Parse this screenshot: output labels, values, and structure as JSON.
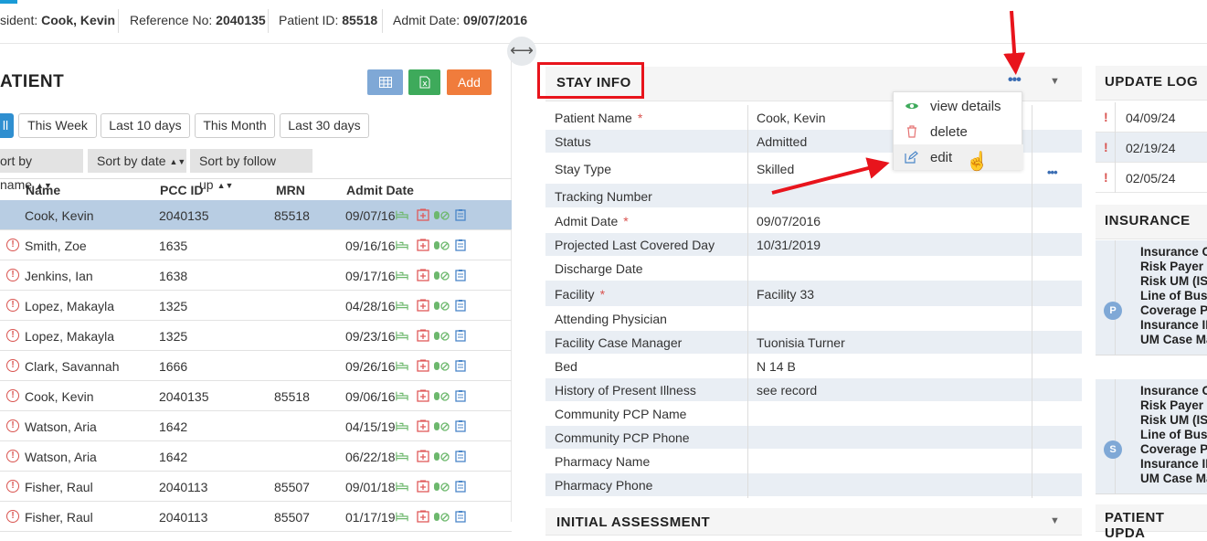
{
  "header": {
    "resident_label": "sident:",
    "resident_value": "Cook, Kevin",
    "reference_label": "Reference No:",
    "reference_value": "2040135",
    "patient_id_label": "Patient ID:",
    "patient_id_value": "85518",
    "admit_label": "Admit Date:",
    "admit_value": "09/07/2016"
  },
  "left": {
    "title": "ATIENT",
    "add_label": "Add",
    "tabs": [
      "ll",
      "This Week",
      "Last 10 days",
      "This Month",
      "Last 30 days"
    ],
    "sorts": [
      "ort by name",
      "Sort by date",
      "Sort by follow up"
    ],
    "columns": {
      "name": "Name",
      "pcc": "PCC ID",
      "mrn": "MRN",
      "admit": "Admit Date"
    },
    "rows": [
      {
        "name": "Cook, Kevin",
        "pcc": "2040135",
        "mrn": "85518",
        "date": "09/07/16"
      },
      {
        "name": "Smith, Zoe",
        "pcc": "1635",
        "mrn": "",
        "date": "09/16/16"
      },
      {
        "name": "Jenkins, Ian",
        "pcc": "1638",
        "mrn": "",
        "date": "09/17/16"
      },
      {
        "name": "Lopez, Makayla",
        "pcc": "1325",
        "mrn": "",
        "date": "04/28/16"
      },
      {
        "name": "Lopez, Makayla",
        "pcc": "1325",
        "mrn": "",
        "date": "09/23/16"
      },
      {
        "name": "Clark, Savannah",
        "pcc": "1666",
        "mrn": "",
        "date": "09/26/16"
      },
      {
        "name": "Cook, Kevin",
        "pcc": "2040135",
        "mrn": "85518",
        "date": "09/06/16"
      },
      {
        "name": "Watson, Aria",
        "pcc": "1642",
        "mrn": "",
        "date": "04/15/19"
      },
      {
        "name": "Watson, Aria",
        "pcc": "1642",
        "mrn": "",
        "date": "06/22/18"
      },
      {
        "name": "Fisher, Raul",
        "pcc": "2040113",
        "mrn": "85507",
        "date": "09/01/18"
      },
      {
        "name": "Fisher, Raul",
        "pcc": "2040113",
        "mrn": "85507",
        "date": "01/17/19"
      }
    ]
  },
  "stay": {
    "title": "STAY INFO",
    "rows": [
      {
        "label": "Patient Name",
        "value": "Cook, Kevin",
        "req": "*"
      },
      {
        "label": "Status",
        "value": "Admitted",
        "req": ""
      },
      {
        "label": "Stay Type",
        "value": "Skilled",
        "req": ""
      },
      {
        "label": "Tracking Number",
        "value": "",
        "req": ""
      },
      {
        "label": "Admit Date",
        "value": "09/07/2016",
        "req": "*"
      },
      {
        "label": "Projected Last Covered Day",
        "value": "10/31/2019",
        "req": ""
      },
      {
        "label": "Discharge Date",
        "value": "",
        "req": ""
      },
      {
        "label": "Facility",
        "value": "Facility 33",
        "req": "*"
      },
      {
        "label": "Attending Physician",
        "value": "",
        "req": ""
      },
      {
        "label": "Facility Case Manager",
        "value": "Tuonisia Turner",
        "req": ""
      },
      {
        "label": "Bed",
        "value": "N 14 B",
        "req": ""
      },
      {
        "label": "History of Present Illness",
        "value": "see record",
        "req": ""
      },
      {
        "label": "Community PCP Name",
        "value": "",
        "req": ""
      },
      {
        "label": "Community PCP Phone",
        "value": "",
        "req": ""
      },
      {
        "label": "Pharmacy Name",
        "value": "",
        "req": ""
      },
      {
        "label": "Pharmacy Phone",
        "value": "",
        "req": ""
      }
    ],
    "next_title": "INITIAL ASSESSMENT"
  },
  "menu": {
    "view": "view details",
    "delete": "delete",
    "edit": "edit"
  },
  "update_log": {
    "title": "UPDATE LOG",
    "entries": [
      "04/09/24",
      "02/19/24",
      "02/05/24"
    ]
  },
  "insurance": {
    "title": "INSURANCE",
    "blocks": [
      {
        "badge": "P",
        "lines": [
          "Insurance C",
          "Risk Payer",
          "Risk UM (IS",
          "Line of Bus",
          "Coverage P",
          "Insurance II",
          "UM Case Ma"
        ]
      },
      {
        "badge": "S",
        "lines": [
          "Insurance C",
          "Risk Payer",
          "Risk UM (IS",
          "Line of Bus",
          "Coverage P",
          "Insurance II",
          "UM Case Ma"
        ]
      }
    ]
  },
  "patient_update_title": "PATIENT UPDA",
  "colors": {
    "accent_blue": "#1a9bd7",
    "grid_btn": "#7fa8d6",
    "excel_btn": "#3eaa5b",
    "add_btn": "#f07c3c",
    "annotation_red": "#e8141c"
  }
}
